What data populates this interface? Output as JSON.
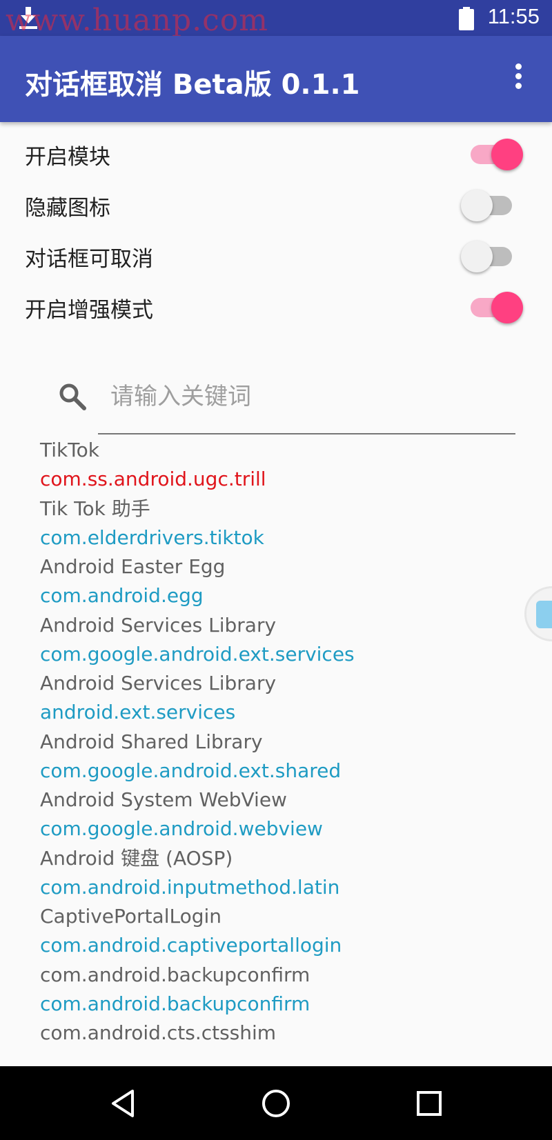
{
  "status_bar": {
    "watermark": "www.huanp.com",
    "time": "11:55",
    "download_icon": "download-icon",
    "battery_icon": "battery-icon"
  },
  "app_bar": {
    "title": "对话框取消 Beta版 0.1.1",
    "menu_icon": "more-vert-icon"
  },
  "settings": [
    {
      "label": "开启模块",
      "on": true
    },
    {
      "label": "隐藏图标",
      "on": false
    },
    {
      "label": "对话框可取消",
      "on": false
    },
    {
      "label": "开启增强模式",
      "on": true
    }
  ],
  "search": {
    "icon": "search-icon",
    "placeholder": "请输入关键词",
    "value": ""
  },
  "apps": [
    {
      "name": "TikTok",
      "package": "com.ss.android.ugc.trill",
      "package_color": "#e0141b"
    },
    {
      "name": "Tik Tok 助手",
      "package": "com.elderdrivers.tiktok",
      "package_color": "#1e9bc3"
    },
    {
      "name": "Android Easter Egg",
      "package": "com.android.egg",
      "package_color": "#1e9bc3"
    },
    {
      "name": "Android Services Library",
      "package": "com.google.android.ext.services",
      "package_color": "#1e9bc3"
    },
    {
      "name": "Android Services Library",
      "package": "android.ext.services",
      "package_color": "#1e9bc3"
    },
    {
      "name": "Android Shared Library",
      "package": "com.google.android.ext.shared",
      "package_color": "#1e9bc3"
    },
    {
      "name": "Android System WebView",
      "package": "com.google.android.webview",
      "package_color": "#1e9bc3"
    },
    {
      "name": "Android 键盘 (AOSP)",
      "package": "com.android.inputmethod.latin",
      "package_color": "#1e9bc3"
    },
    {
      "name": "CaptivePortalLogin",
      "package": "com.android.captiveportallogin",
      "package_color": "#1e9bc3"
    },
    {
      "name": "com.android.backupconfirm",
      "package": "com.android.backupconfirm",
      "package_color": "#1e9bc3"
    },
    {
      "name": "com.android.cts.ctsshim",
      "package": "",
      "package_color": "#1e9bc3"
    }
  ],
  "nav_bar": {
    "back_icon": "back-triangle-icon",
    "home_icon": "home-circle-icon",
    "recents_icon": "recents-square-icon"
  },
  "colors": {
    "primary": "#3f51b5",
    "primary_dark": "#303f9f",
    "accent": "#ff4081"
  }
}
